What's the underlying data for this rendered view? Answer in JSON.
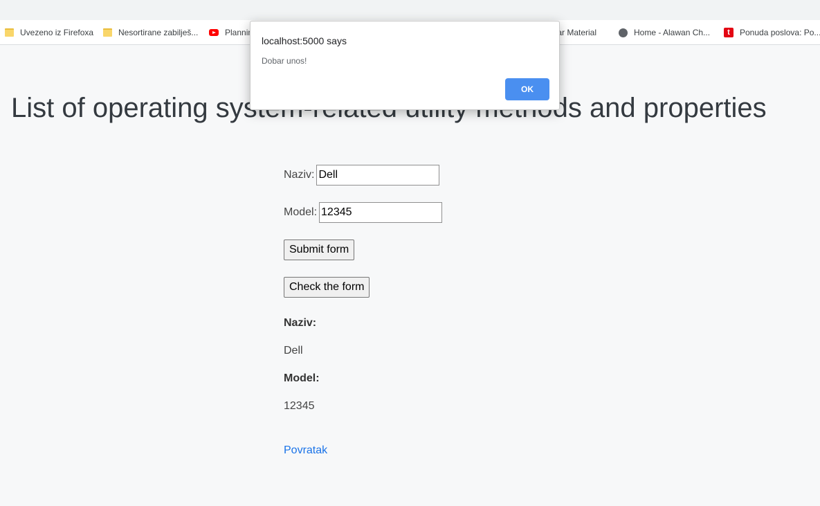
{
  "bookmarks": [
    {
      "label": "Uvezeno iz Firefoxa",
      "icon": "folder-icon"
    },
    {
      "label": "Nesortirane zabilješ...",
      "icon": "folder-icon"
    },
    {
      "label": "Plannin",
      "icon": "youtube-icon"
    },
    {
      "label": "ular Material",
      "icon": "none"
    },
    {
      "label": "Home - Alawan Ch...",
      "icon": "globe-icon"
    },
    {
      "label": "Ponuda poslova: Po...",
      "icon": "tportal-icon"
    }
  ],
  "page": {
    "title": "List of operating system-related utility methods and properties"
  },
  "form": {
    "naziv_label": "Naziv:",
    "naziv_value": "Dell",
    "model_label": "Model:",
    "model_value": "12345",
    "submit_label": "Submit form",
    "check_label": "Check the form"
  },
  "result": {
    "naziv_label": "Naziv:",
    "naziv_value": "Dell",
    "model_label": "Model:",
    "model_value": "12345",
    "back_link": "Povratak"
  },
  "dialog": {
    "title": "localhost:5000 says",
    "message": "Dobar unos!",
    "ok_label": "OK"
  },
  "colors": {
    "link": "#1a73e8",
    "ok_button": "#4a8ff0",
    "background": "#f7f8f9"
  }
}
